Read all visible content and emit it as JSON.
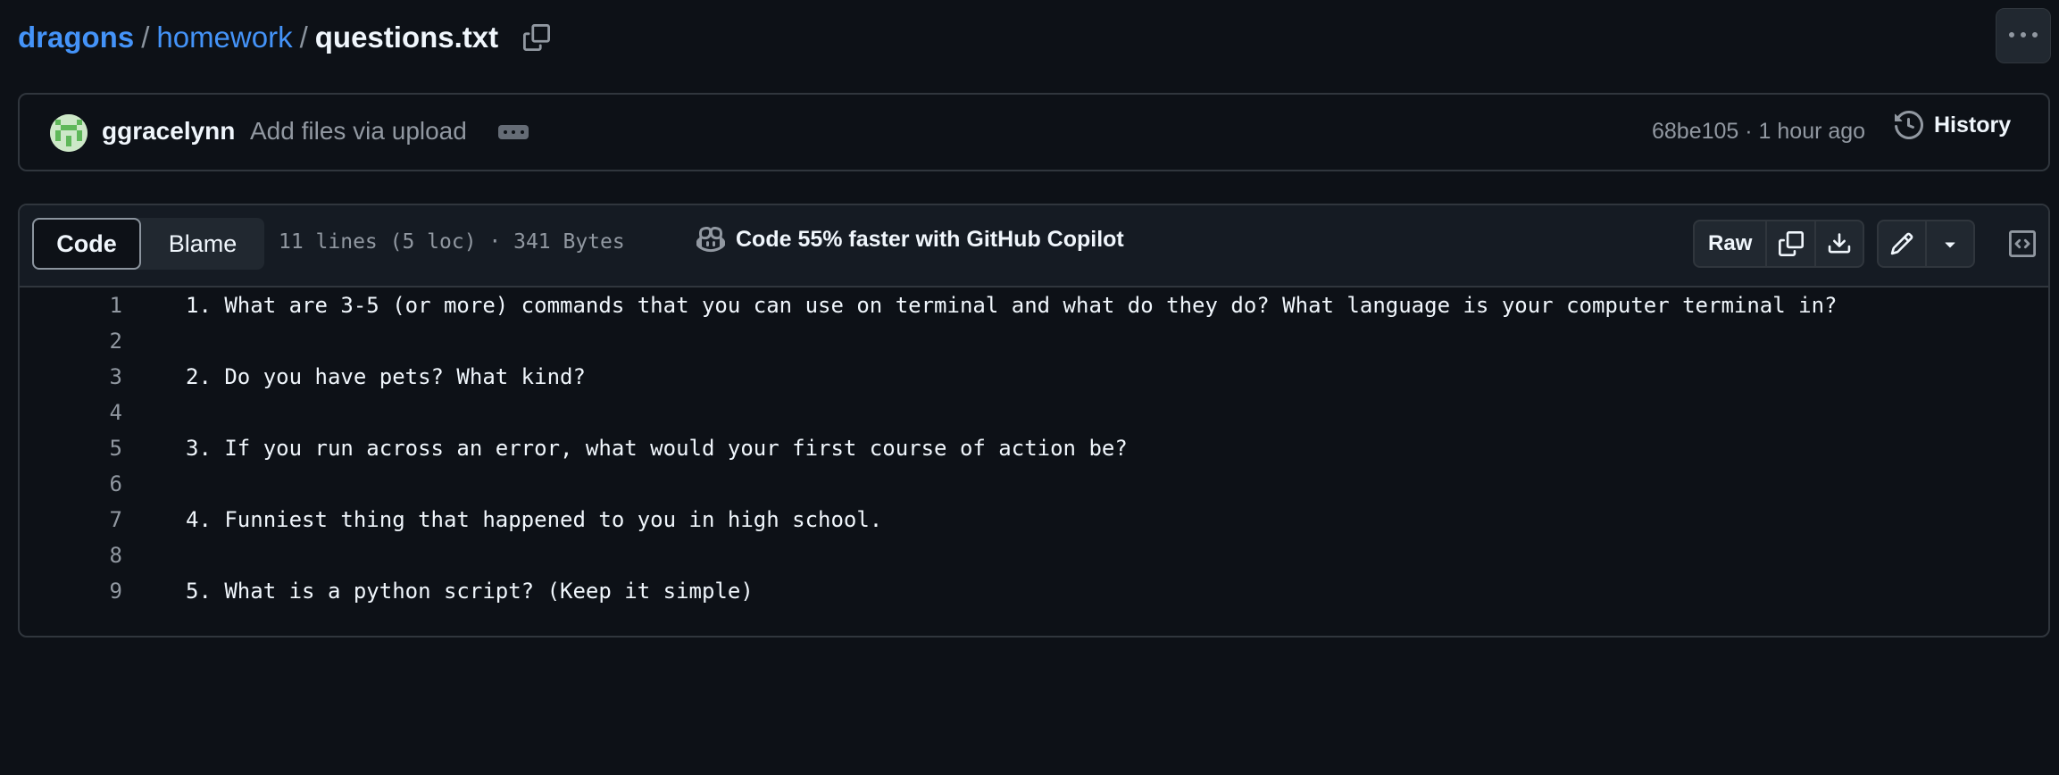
{
  "breadcrumb": {
    "repo": "dragons",
    "folder": "homework",
    "file": "questions.txt"
  },
  "commit": {
    "author": "ggracelynn",
    "message": "Add files via upload",
    "sha_time": "68be105 · 1 hour ago",
    "history_label": "History"
  },
  "file": {
    "tab_code": "Code",
    "tab_blame": "Blame",
    "meta": "11 lines (5 loc) · 341 Bytes",
    "copilot": "Code 55% faster with GitHub Copilot",
    "raw_label": "Raw"
  },
  "lines": [
    {
      "n": "1",
      "text": "1. What are 3-5 (or more) commands that you can use on terminal and what do they do? What language is your computer terminal in?"
    },
    {
      "n": "2",
      "text": ""
    },
    {
      "n": "3",
      "text": "2. Do you have pets? What kind?"
    },
    {
      "n": "4",
      "text": ""
    },
    {
      "n": "5",
      "text": "3. If you run across an error, what would your first course of action be?"
    },
    {
      "n": "6",
      "text": ""
    },
    {
      "n": "7",
      "text": "4. Funniest thing that happened to you in high school."
    },
    {
      "n": "8",
      "text": ""
    },
    {
      "n": "9",
      "text": "5. What is a python script? (Keep it simple)"
    }
  ],
  "colors": {
    "background": "#0d1117",
    "link": "#4493f8",
    "border": "#30363d",
    "muted": "#9198a1"
  }
}
